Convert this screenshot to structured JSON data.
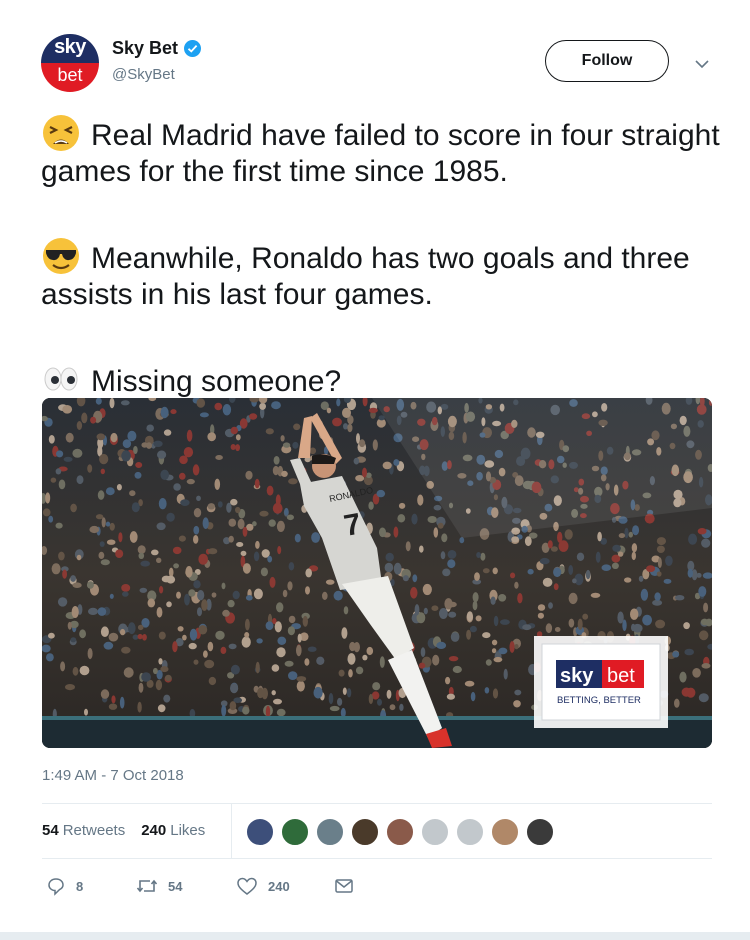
{
  "author": {
    "avatar_top": "sky",
    "avatar_bottom": "bet",
    "display_name": "Sky Bet",
    "handle": "@SkyBet",
    "verified_icon": "verified-badge-icon"
  },
  "follow_label": "Follow",
  "tweet": {
    "paragraphs": [
      {
        "emoji": "tired-face-emoji",
        "text": "Real Madrid have failed to score in four straight games for the first time since 1985."
      },
      {
        "emoji": "sunglasses-emoji",
        "text": "Meanwhile, Ronaldo has two goals and three assists in his last four games."
      },
      {
        "emoji": "eyes-emoji",
        "text": "Missing someone?"
      }
    ]
  },
  "media": {
    "jersey_name": "RONALDO",
    "jersey_number": "7",
    "brand_sky": "sky",
    "brand_bet": "bet",
    "brand_tagline": "BETTING, BETTER"
  },
  "timestamp": "1:49 AM - 7 Oct 2018",
  "stats": {
    "retweets_count": "54",
    "retweets_label": "Retweets",
    "likes_count": "240",
    "likes_label": "Likes"
  },
  "liker_colors": [
    "#3d4f7a",
    "#2f6b3a",
    "#6a7f8a",
    "#4a3a2a",
    "#8a5a4a",
    "#c2c8cc",
    "#c2c8cc",
    "#b08868",
    "#3a3a3a"
  ],
  "actions": {
    "reply_count": "8",
    "retweet_count": "54",
    "like_count": "240"
  },
  "colors": {
    "brand_blue": "#1e2e63",
    "brand_red": "#e01b24",
    "twitter_blue": "#1da1f2",
    "muted_text": "#657786"
  }
}
